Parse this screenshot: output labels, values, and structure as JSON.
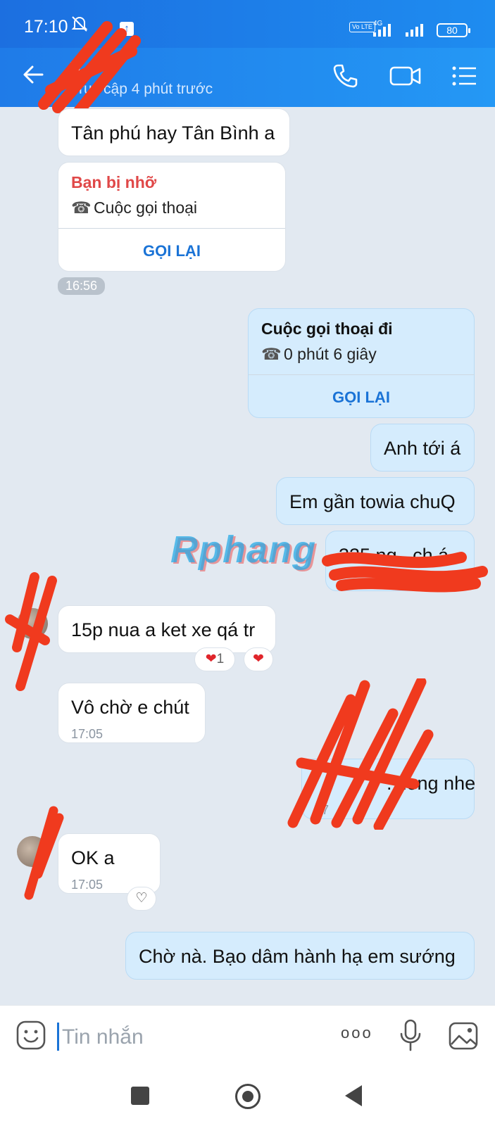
{
  "status_bar": {
    "time": "17:10",
    "network_label": "4G",
    "volte_label": "Vo LTE",
    "battery": "80"
  },
  "header": {
    "name": "V",
    "last_seen": "Truy cập 4 phút trước",
    "accent": "#1f7be8"
  },
  "messages": [
    {
      "id": "m1",
      "side": "in",
      "text": "Tân phú hay Tân Bình a"
    },
    {
      "id": "m2",
      "side": "in",
      "type": "missed-call",
      "title": "Bạn bị nhỡ",
      "subtitle": "Cuộc gọi thoại",
      "action": "GỌI LẠI",
      "title_color": "#e04848"
    },
    {
      "id": "chip1",
      "type": "time-chip",
      "text": "16:56"
    },
    {
      "id": "m3",
      "side": "out",
      "type": "outgoing-call",
      "title": "Cuộc gọi thoại đi",
      "subtitle": "0 phút 6 giây",
      "action": "GỌI LẠI"
    },
    {
      "id": "m4",
      "side": "out",
      "text": "Anh tới á"
    },
    {
      "id": "m5",
      "side": "out",
      "text": "Em gần towia chuQ"
    },
    {
      "id": "m6",
      "side": "out",
      "text": "335 ng...ch á",
      "redacted": true
    },
    {
      "id": "m7",
      "side": "in",
      "text": "15p nua a ket xe qá tr",
      "reaction_count": "1"
    },
    {
      "id": "m8",
      "side": "in",
      "text": "Vô chờ e chút",
      "time": "17:05"
    },
    {
      "id": "m9",
      "side": "out",
      "text": "...long nhe",
      "time": "17",
      "redacted": true
    },
    {
      "id": "m10",
      "side": "in",
      "text": "OK a",
      "time": "17:05"
    },
    {
      "id": "m11",
      "side": "out",
      "text": "Chờ nà. Bạo dâm hành hạ em sướng"
    }
  ],
  "watermark": "Rphang",
  "composer": {
    "placeholder": "Tin nhắn",
    "more_label": "ooo"
  },
  "icons": {
    "back": "back-arrow-icon",
    "call": "phone-icon",
    "video": "video-camera-icon",
    "menu": "list-menu-icon",
    "emoji": "emoji-icon",
    "mic": "microphone-icon",
    "image": "image-icon",
    "heart": "heart-icon"
  }
}
